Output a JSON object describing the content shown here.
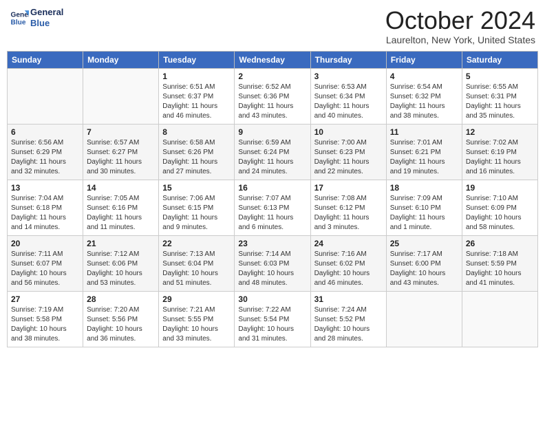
{
  "logo": {
    "line1": "General",
    "line2": "Blue"
  },
  "title": "October 2024",
  "location": "Laurelton, New York, United States",
  "days_of_week": [
    "Sunday",
    "Monday",
    "Tuesday",
    "Wednesday",
    "Thursday",
    "Friday",
    "Saturday"
  ],
  "weeks": [
    [
      null,
      null,
      {
        "day": "1",
        "sunrise": "Sunrise: 6:51 AM",
        "sunset": "Sunset: 6:37 PM",
        "daylight": "Daylight: 11 hours and 46 minutes."
      },
      {
        "day": "2",
        "sunrise": "Sunrise: 6:52 AM",
        "sunset": "Sunset: 6:36 PM",
        "daylight": "Daylight: 11 hours and 43 minutes."
      },
      {
        "day": "3",
        "sunrise": "Sunrise: 6:53 AM",
        "sunset": "Sunset: 6:34 PM",
        "daylight": "Daylight: 11 hours and 40 minutes."
      },
      {
        "day": "4",
        "sunrise": "Sunrise: 6:54 AM",
        "sunset": "Sunset: 6:32 PM",
        "daylight": "Daylight: 11 hours and 38 minutes."
      },
      {
        "day": "5",
        "sunrise": "Sunrise: 6:55 AM",
        "sunset": "Sunset: 6:31 PM",
        "daylight": "Daylight: 11 hours and 35 minutes."
      }
    ],
    [
      {
        "day": "6",
        "sunrise": "Sunrise: 6:56 AM",
        "sunset": "Sunset: 6:29 PM",
        "daylight": "Daylight: 11 hours and 32 minutes."
      },
      {
        "day": "7",
        "sunrise": "Sunrise: 6:57 AM",
        "sunset": "Sunset: 6:27 PM",
        "daylight": "Daylight: 11 hours and 30 minutes."
      },
      {
        "day": "8",
        "sunrise": "Sunrise: 6:58 AM",
        "sunset": "Sunset: 6:26 PM",
        "daylight": "Daylight: 11 hours and 27 minutes."
      },
      {
        "day": "9",
        "sunrise": "Sunrise: 6:59 AM",
        "sunset": "Sunset: 6:24 PM",
        "daylight": "Daylight: 11 hours and 24 minutes."
      },
      {
        "day": "10",
        "sunrise": "Sunrise: 7:00 AM",
        "sunset": "Sunset: 6:23 PM",
        "daylight": "Daylight: 11 hours and 22 minutes."
      },
      {
        "day": "11",
        "sunrise": "Sunrise: 7:01 AM",
        "sunset": "Sunset: 6:21 PM",
        "daylight": "Daylight: 11 hours and 19 minutes."
      },
      {
        "day": "12",
        "sunrise": "Sunrise: 7:02 AM",
        "sunset": "Sunset: 6:19 PM",
        "daylight": "Daylight: 11 hours and 16 minutes."
      }
    ],
    [
      {
        "day": "13",
        "sunrise": "Sunrise: 7:04 AM",
        "sunset": "Sunset: 6:18 PM",
        "daylight": "Daylight: 11 hours and 14 minutes."
      },
      {
        "day": "14",
        "sunrise": "Sunrise: 7:05 AM",
        "sunset": "Sunset: 6:16 PM",
        "daylight": "Daylight: 11 hours and 11 minutes."
      },
      {
        "day": "15",
        "sunrise": "Sunrise: 7:06 AM",
        "sunset": "Sunset: 6:15 PM",
        "daylight": "Daylight: 11 hours and 9 minutes."
      },
      {
        "day": "16",
        "sunrise": "Sunrise: 7:07 AM",
        "sunset": "Sunset: 6:13 PM",
        "daylight": "Daylight: 11 hours and 6 minutes."
      },
      {
        "day": "17",
        "sunrise": "Sunrise: 7:08 AM",
        "sunset": "Sunset: 6:12 PM",
        "daylight": "Daylight: 11 hours and 3 minutes."
      },
      {
        "day": "18",
        "sunrise": "Sunrise: 7:09 AM",
        "sunset": "Sunset: 6:10 PM",
        "daylight": "Daylight: 11 hours and 1 minute."
      },
      {
        "day": "19",
        "sunrise": "Sunrise: 7:10 AM",
        "sunset": "Sunset: 6:09 PM",
        "daylight": "Daylight: 10 hours and 58 minutes."
      }
    ],
    [
      {
        "day": "20",
        "sunrise": "Sunrise: 7:11 AM",
        "sunset": "Sunset: 6:07 PM",
        "daylight": "Daylight: 10 hours and 56 minutes."
      },
      {
        "day": "21",
        "sunrise": "Sunrise: 7:12 AM",
        "sunset": "Sunset: 6:06 PM",
        "daylight": "Daylight: 10 hours and 53 minutes."
      },
      {
        "day": "22",
        "sunrise": "Sunrise: 7:13 AM",
        "sunset": "Sunset: 6:04 PM",
        "daylight": "Daylight: 10 hours and 51 minutes."
      },
      {
        "day": "23",
        "sunrise": "Sunrise: 7:14 AM",
        "sunset": "Sunset: 6:03 PM",
        "daylight": "Daylight: 10 hours and 48 minutes."
      },
      {
        "day": "24",
        "sunrise": "Sunrise: 7:16 AM",
        "sunset": "Sunset: 6:02 PM",
        "daylight": "Daylight: 10 hours and 46 minutes."
      },
      {
        "day": "25",
        "sunrise": "Sunrise: 7:17 AM",
        "sunset": "Sunset: 6:00 PM",
        "daylight": "Daylight: 10 hours and 43 minutes."
      },
      {
        "day": "26",
        "sunrise": "Sunrise: 7:18 AM",
        "sunset": "Sunset: 5:59 PM",
        "daylight": "Daylight: 10 hours and 41 minutes."
      }
    ],
    [
      {
        "day": "27",
        "sunrise": "Sunrise: 7:19 AM",
        "sunset": "Sunset: 5:58 PM",
        "daylight": "Daylight: 10 hours and 38 minutes."
      },
      {
        "day": "28",
        "sunrise": "Sunrise: 7:20 AM",
        "sunset": "Sunset: 5:56 PM",
        "daylight": "Daylight: 10 hours and 36 minutes."
      },
      {
        "day": "29",
        "sunrise": "Sunrise: 7:21 AM",
        "sunset": "Sunset: 5:55 PM",
        "daylight": "Daylight: 10 hours and 33 minutes."
      },
      {
        "day": "30",
        "sunrise": "Sunrise: 7:22 AM",
        "sunset": "Sunset: 5:54 PM",
        "daylight": "Daylight: 10 hours and 31 minutes."
      },
      {
        "day": "31",
        "sunrise": "Sunrise: 7:24 AM",
        "sunset": "Sunset: 5:52 PM",
        "daylight": "Daylight: 10 hours and 28 minutes."
      },
      null,
      null
    ]
  ]
}
